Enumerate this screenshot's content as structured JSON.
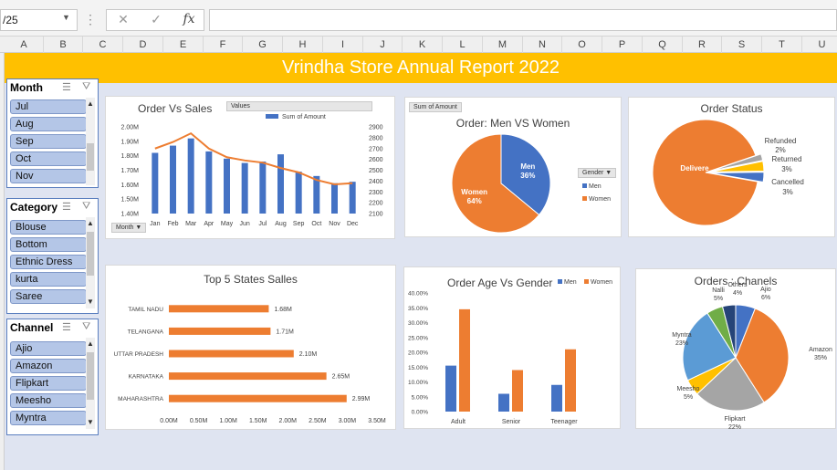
{
  "formula_bar": {
    "name_box": "/25",
    "dots": "⋮",
    "cancel_icon": "✕",
    "enter_icon": "✓",
    "fx_label": "fx",
    "formula": ""
  },
  "columns": [
    "A",
    "B",
    "C",
    "D",
    "E",
    "F",
    "G",
    "H",
    "I",
    "J",
    "K",
    "L",
    "M",
    "N",
    "O",
    "P",
    "Q",
    "R",
    "S",
    "T",
    "U"
  ],
  "title": "Vrindha Store Annual Report 2022",
  "slicers": {
    "month": {
      "title": "Month",
      "items": [
        "Jul",
        "Aug",
        "Sep",
        "Oct",
        "Nov"
      ]
    },
    "category": {
      "title": "Category",
      "items": [
        "Blouse",
        "Bottom",
        "Ethnic Dress",
        "kurta",
        "Saree"
      ]
    },
    "channel": {
      "title": "Channel",
      "items": [
        "Ajio",
        "Amazon",
        "Flipkart",
        "Meesho",
        "Myntra"
      ]
    }
  },
  "colors": {
    "blue": "#4472c4",
    "orange": "#ed7d31",
    "gray": "#a5a5a5",
    "yellow": "#ffc000",
    "lightblue": "#5b9bd5",
    "green": "#70ad47",
    "navy": "#264478"
  },
  "chart_data": [
    {
      "id": "order-vs-sales",
      "type": "bar",
      "title": "Order Vs Sales",
      "pill_values": "Values",
      "pill_month": "Month ▼",
      "legend": "Sum of Amount",
      "categories": [
        "Jan",
        "Feb",
        "Mar",
        "Apr",
        "May",
        "Jun",
        "Jul",
        "Aug",
        "Sep",
        "Oct",
        "Nov",
        "Dec"
      ],
      "bar_values": [
        1.82,
        1.87,
        1.92,
        1.83,
        1.78,
        1.75,
        1.76,
        1.81,
        1.69,
        1.66,
        1.61,
        1.62
      ],
      "line_values": [
        2700,
        2760,
        2840,
        2700,
        2620,
        2590,
        2570,
        2520,
        2480,
        2410,
        2370,
        2380
      ],
      "y_ticks": [
        "2.00M",
        "1.90M",
        "1.80M",
        "1.70M",
        "1.60M",
        "1.50M",
        "1.40M"
      ],
      "y2_ticks": [
        "2900",
        "2800",
        "2700",
        "2600",
        "2500",
        "2400",
        "2300",
        "2200",
        "2100"
      ],
      "ylim": [
        1.4,
        2.0
      ],
      "y2lim": [
        2100,
        2900
      ]
    },
    {
      "id": "men-vs-women",
      "type": "pie",
      "title": "Order: Men VS Women",
      "pill": "Sum of Amount",
      "legend_title": "Gender ▼",
      "labels": [
        "Men",
        "Women"
      ],
      "values": [
        36,
        64
      ],
      "value_labels": [
        "36%",
        "64%"
      ]
    },
    {
      "id": "order-status",
      "type": "pie",
      "title": "Order Status",
      "labels": [
        "Delivered",
        "Refunded",
        "Returned",
        "Cancelled"
      ],
      "values": [
        92,
        2,
        3,
        3
      ],
      "value_labels": [
        "",
        "2%",
        "3%",
        "3%"
      ],
      "display_names": [
        "Delivere",
        "Refunded",
        "Returned",
        "Cancelled"
      ]
    },
    {
      "id": "top-states",
      "type": "bar",
      "orientation": "horizontal",
      "title": "Top  5 States Salles",
      "categories": [
        "TAMIL NADU",
        "TELANGANA",
        "UTTAR PRADESH",
        "KARNATAKA",
        "MAHARASHTRA"
      ],
      "values": [
        1.68,
        1.71,
        2.1,
        2.65,
        2.99
      ],
      "value_labels": [
        "1.68M",
        "1.71M",
        "2.10M",
        "2.65M",
        "2.99M"
      ],
      "x_ticks": [
        "0.00M",
        "0.50M",
        "1.00M",
        "1.50M",
        "2.00M",
        "2.50M",
        "3.00M",
        "3.50M"
      ],
      "xlim": [
        0,
        3.5
      ]
    },
    {
      "id": "age-vs-gender",
      "type": "bar",
      "title": "Order Age Vs Gender",
      "categories": [
        "Adult",
        "Senior",
        "Teenager"
      ],
      "series": [
        {
          "name": "Men",
          "values": [
            15.5,
            6.0,
            9.0
          ]
        },
        {
          "name": "Women",
          "values": [
            34.5,
            14.0,
            21.0
          ]
        }
      ],
      "y_ticks": [
        "40.00%",
        "35.00%",
        "30.00%",
        "25.00%",
        "20.00%",
        "15.00%",
        "10.00%",
        "5.00%",
        "0.00%"
      ],
      "ylim": [
        0,
        40
      ]
    },
    {
      "id": "channels",
      "type": "pie",
      "title": "Orders : Chanels",
      "labels": [
        "Ajio",
        "Amazon",
        "Flipkart",
        "Meesho",
        "Myntra",
        "Nalli",
        "Others"
      ],
      "values": [
        6,
        35,
        22,
        5,
        23,
        5,
        4
      ],
      "value_labels": [
        "6%",
        "35%",
        "22%",
        "5%",
        "23%",
        "5%",
        "4%"
      ]
    }
  ]
}
